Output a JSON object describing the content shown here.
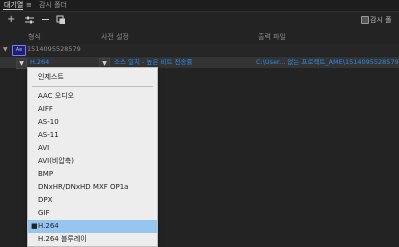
{
  "tabs": {
    "active": "대기열",
    "menu_glyph": "≡",
    "inactive": "감시 폴더"
  },
  "toolbar": {
    "add_icon": "plus-icon",
    "settings_icon": "sliders-icon",
    "remove_icon": "minus-icon",
    "duplicate_icon": "duplicate-icon",
    "watch_label": "감시 폴"
  },
  "columns": {
    "format": "형식",
    "preset": "사전 설정",
    "output": "출력 파일"
  },
  "group": {
    "badge": "Ae",
    "id": "1514095528579"
  },
  "job": {
    "format_value": "H.264",
    "preset_value": "소스 일치 - 높은 비트 전송률",
    "output_value": "C:\\User... 없는 프로젝트_AME\\1514095528579_1.a"
  },
  "dropdown": {
    "items": [
      {
        "label": "인제스트",
        "selected": false
      },
      {
        "label": "AAC 오디오",
        "selected": false
      },
      {
        "label": "AIFF",
        "selected": false
      },
      {
        "label": "AS-10",
        "selected": false
      },
      {
        "label": "AS-11",
        "selected": false
      },
      {
        "label": "AVI",
        "selected": false
      },
      {
        "label": "AVI(비압축)",
        "selected": false
      },
      {
        "label": "BMP",
        "selected": false
      },
      {
        "label": "DNxHR/DNxHD MXF OP1a",
        "selected": false
      },
      {
        "label": "DPX",
        "selected": false
      },
      {
        "label": "GIF",
        "selected": false
      },
      {
        "label": "H.264",
        "selected": true
      },
      {
        "label": "H.264 블루레이",
        "selected": false
      }
    ],
    "selected_bullet": "■"
  },
  "colors": {
    "link_blue": "#2d8ceb",
    "selection": "#95c6f0"
  }
}
